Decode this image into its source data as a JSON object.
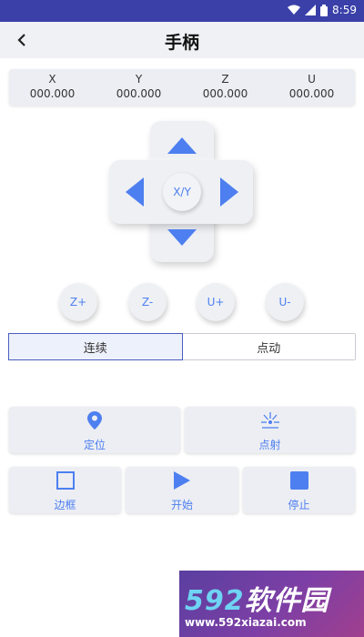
{
  "status_bar": {
    "time": "8:59"
  },
  "app_bar": {
    "title": "手柄",
    "back_glyph": "‹"
  },
  "coordinates": [
    {
      "axis": "X",
      "value": "000.000"
    },
    {
      "axis": "Y",
      "value": "000.000"
    },
    {
      "axis": "Z",
      "value": "000.000"
    },
    {
      "axis": "U",
      "value": "000.000"
    }
  ],
  "dpad": {
    "center_label": "X/Y"
  },
  "axis_buttons": [
    "Z+",
    "Z-",
    "U+",
    "U-"
  ],
  "mode_toggle": {
    "options": [
      "连续",
      "点动"
    ],
    "selected": "连续"
  },
  "actions": {
    "locate": "定位",
    "fire": "点射",
    "frame": "边框",
    "start": "开始",
    "stop": "停止"
  },
  "watermark": {
    "logo_num": "592",
    "logo_text": "软件园",
    "url": "www.592xiazai.com"
  },
  "colors": {
    "accent": "#4d7ff0",
    "status_bar": "#3a40a8",
    "panel": "#eceef3"
  }
}
